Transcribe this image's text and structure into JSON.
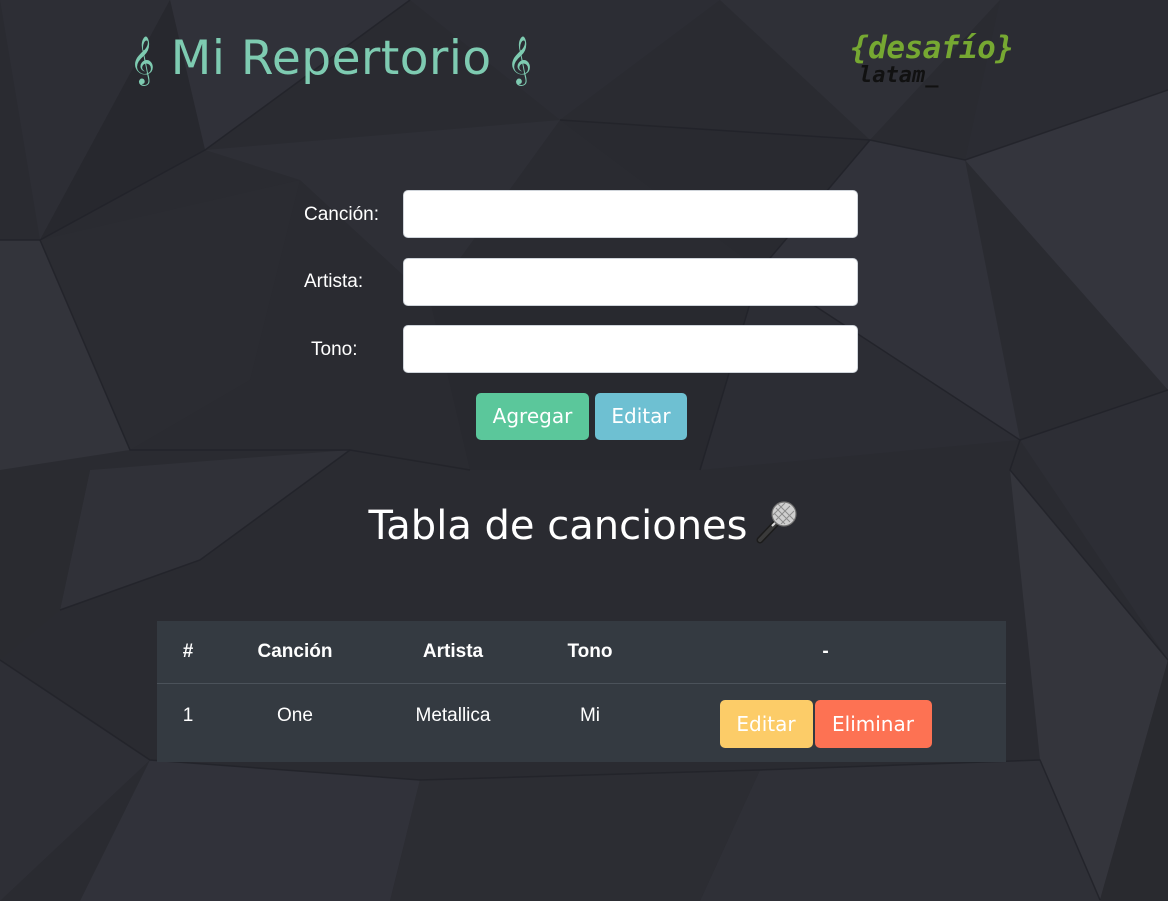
{
  "header": {
    "title": "Mi Repertorio",
    "clef_left": "𝄞",
    "clef_right": "𝄞",
    "logo_top": "{desafío}",
    "logo_bottom": "latam_"
  },
  "form": {
    "cancion_label": "Canción:",
    "artista_label": "Artista:",
    "tono_label": "Tono:",
    "cancion_value": "",
    "artista_value": "",
    "tono_value": "",
    "add_button": "Agregar",
    "edit_button": "Editar"
  },
  "section": {
    "title": "Tabla de canciones",
    "icon": "microphone-icon"
  },
  "table": {
    "headers": [
      "#",
      "Canción",
      "Artista",
      "Tono",
      "-"
    ],
    "rows": [
      {
        "index": "1",
        "cancion": "One",
        "artista": "Metallica",
        "tono": "Mi",
        "edit_label": "Editar",
        "delete_label": "Eliminar"
      }
    ]
  },
  "colors": {
    "background": "#2a2b31",
    "title": "#7ecbb1",
    "logo_green": "#76a832",
    "agregar": "#5bc79b",
    "editar_form": "#6ec0d2",
    "editar_row": "#fccc68",
    "eliminar": "#fd7253",
    "table_bg": "#343a41"
  }
}
